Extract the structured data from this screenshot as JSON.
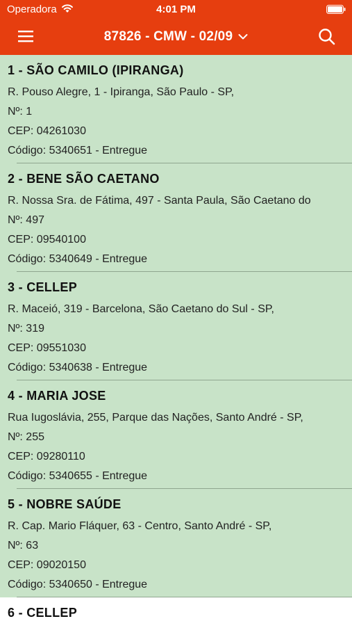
{
  "status_bar": {
    "carrier": "Operadora",
    "time": "4:01 PM"
  },
  "nav": {
    "title": "87826 - CMW - 02/09",
    "menu_icon": "hamburger-icon",
    "search_icon": "search-icon"
  },
  "colors": {
    "header": "#e63e0f",
    "row_delivered": "#c8e3c8",
    "row_pending": "#ffffff"
  },
  "deliveries": [
    {
      "title": "1 - SÃO CAMILO (IPIRANGA)",
      "address": "R. Pouso Alegre, 1 - Ipiranga, São Paulo - SP,",
      "number": "Nº: 1",
      "cep": "CEP: 04261030",
      "code": "Código: 5340651 - Entregue"
    },
    {
      "title": "2 - BENE SÃO CAETANO",
      "address": "R. Nossa Sra. de Fátima, 497 - Santa Paula, São Caetano do",
      "number": "Nº: 497",
      "cep": "CEP: 09540100",
      "code": "Código: 5340649 - Entregue"
    },
    {
      "title": "3 - CELLEP",
      "address": "R. Maceió, 319 - Barcelona, São Caetano do Sul - SP,",
      "number": "Nº: 319",
      "cep": "CEP: 09551030",
      "code": "Código: 5340638 - Entregue"
    },
    {
      "title": "4 - MARIA JOSE",
      "address": "Rua Iugoslávia, 255, Parque das Nações, Santo André - SP,",
      "number": "Nº: 255",
      "cep": "CEP: 09280110",
      "code": "Código: 5340655 - Entregue"
    },
    {
      "title": "5 - NOBRE SAÚDE",
      "address": "R. Cap. Mario Fláquer, 63 - Centro, Santo André - SP,",
      "number": "Nº: 63",
      "cep": "CEP: 09020150",
      "code": "Código: 5340650 - Entregue"
    },
    {
      "title": "6 - CELLEP"
    }
  ]
}
